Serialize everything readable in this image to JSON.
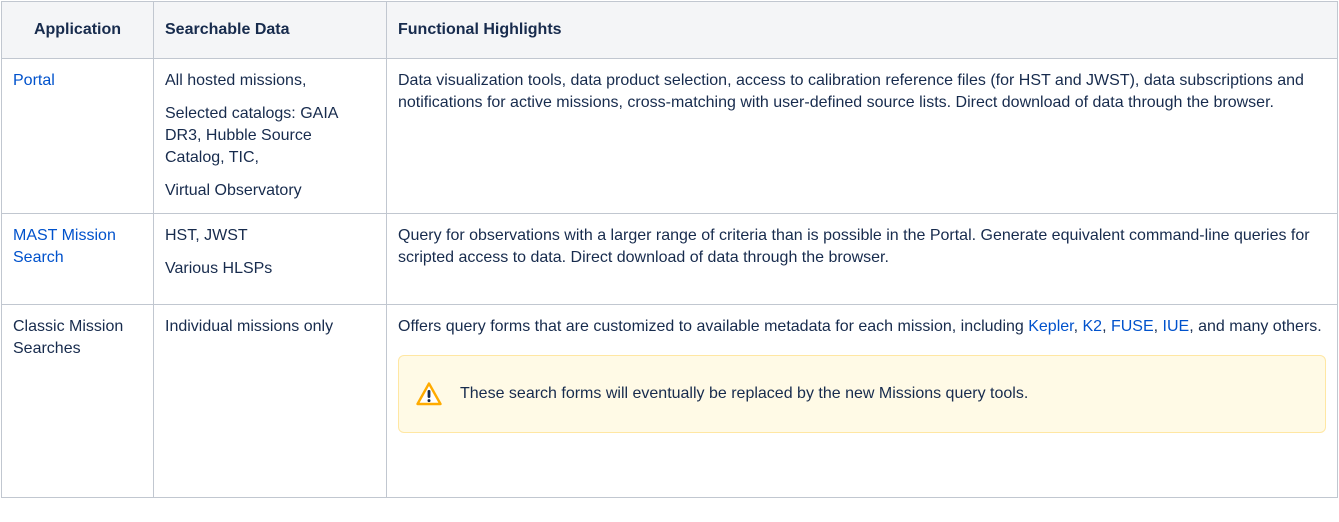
{
  "headers": {
    "application": "Application",
    "searchable": "Searchable Data",
    "highlights": "Functional Highlights"
  },
  "rows": [
    {
      "application": "Portal",
      "searchable": [
        "All hosted missions,",
        "Selected catalogs: GAIA DR3, Hubble Source Catalog, TIC,",
        "Virtual Observatory"
      ],
      "highlights": "Data visualization tools, data product selection, access to calibration reference files (for HST and JWST), data subscriptions and notifications for active missions, cross-matching with user-defined source lists. Direct download of data through the browser."
    },
    {
      "application": "MAST Mission Search",
      "searchable": [
        "HST, JWST",
        "Various HLSPs"
      ],
      "highlights": "Query for observations with a larger range of criteria than is possible in the Portal. Generate equivalent command-line queries for scripted access to data. Direct download of data through the browser."
    },
    {
      "application": "Classic Mission Searches",
      "searchable": [
        "Individual missions only"
      ],
      "highlights_prefix": "Offers query forms that are customized to available metadata for each mission, including ",
      "links": [
        "Kepler",
        "K2",
        "FUSE",
        "IUE"
      ],
      "separator": ", ",
      "highlights_suffix": ", and many others.",
      "warning": "These search forms will eventually be replaced by the new Missions query tools.",
      "warning_icon": "warning-icon"
    }
  ],
  "colors": {
    "link": "#0052cc",
    "header_bg": "#f4f5f7",
    "border": "#c1c7d0",
    "warning_bg": "#fffae6",
    "warning_border": "#ffe7a3",
    "warning_icon": "#ffab00"
  }
}
